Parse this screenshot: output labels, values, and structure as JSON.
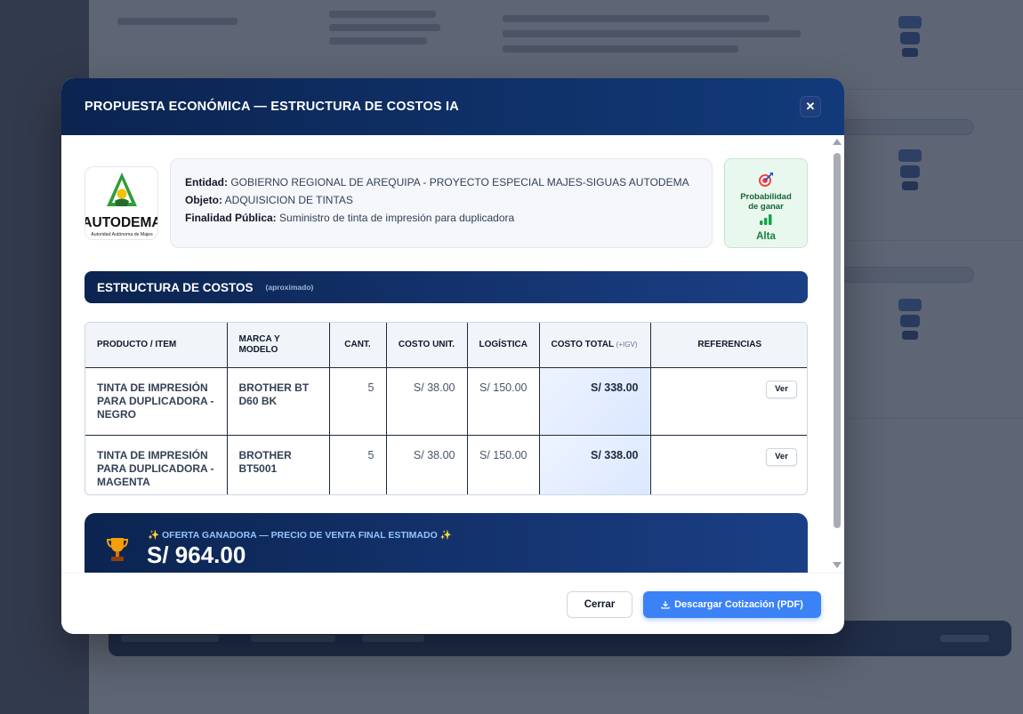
{
  "modal": {
    "title": "PROPUESTA ECONÓMICA — ESTRUCTURA DE COSTOS IA",
    "close_label": "✕"
  },
  "logo": {
    "name": "AUTODEMA",
    "caption": "Autoridad Autónoma de Majes"
  },
  "info": {
    "entidad_label": "Entidad:",
    "entidad_value": "GOBIERNO REGIONAL DE AREQUIPA - PROYECTO ESPECIAL MAJES-SIGUAS AUTODEMA",
    "objeto_label": "Objeto:",
    "objeto_value": "ADQUISICION DE TINTAS",
    "finalidad_label": "Finalidad Pública:",
    "finalidad_value": "Suministro de tinta de impresión para duplicadora"
  },
  "probability": {
    "label_line1": "Probabilidad",
    "label_line2": "de ganar",
    "value": "Alta",
    "icon": "target-icon",
    "color": "#15803d"
  },
  "cost_section": {
    "title": "ESTRUCTURA DE COSTOS",
    "subtitle": "(aproximado)"
  },
  "table": {
    "headers": {
      "product": "PRODUCTO / ITEM",
      "brand": "MARCA Y MODELO",
      "qty": "CANT.",
      "unit_cost": "COSTO UNIT.",
      "logistics": "LOGÍSTICA",
      "total": "COSTO TOTAL",
      "total_note": "(+IGV)",
      "refs": "REFERENCIAS"
    },
    "rows": [
      {
        "product": "TINTA DE IMPRESIÓN PARA DUPLICADORA - NEGRO",
        "brand": "BROTHER BT D60 BK",
        "qty": "5",
        "unit_cost": "S/ 38.00",
        "logistics": "S/ 150.00",
        "total": "S/ 338.00",
        "ref_label": "Ver"
      },
      {
        "product": "TINTA DE IMPRESIÓN PARA DUPLICADORA - MAGENTA",
        "brand": "BROTHER BT5001",
        "qty": "5",
        "unit_cost": "S/ 38.00",
        "logistics": "S/ 150.00",
        "total": "S/ 338.00",
        "ref_label": "Ver"
      }
    ]
  },
  "offer": {
    "label": "✨ OFERTA GANADORA — PRECIO DE VENTA FINAL ESTIMADO ✨",
    "amount": "S/ 964.00",
    "icon": "trophy-icon"
  },
  "footer": {
    "close_label": "Cerrar",
    "download_label": "Descargar Cotización (PDF)"
  },
  "colors": {
    "header_navy": "#0b2450",
    "accent_blue": "#3b82f6",
    "success_green": "#15803d"
  }
}
